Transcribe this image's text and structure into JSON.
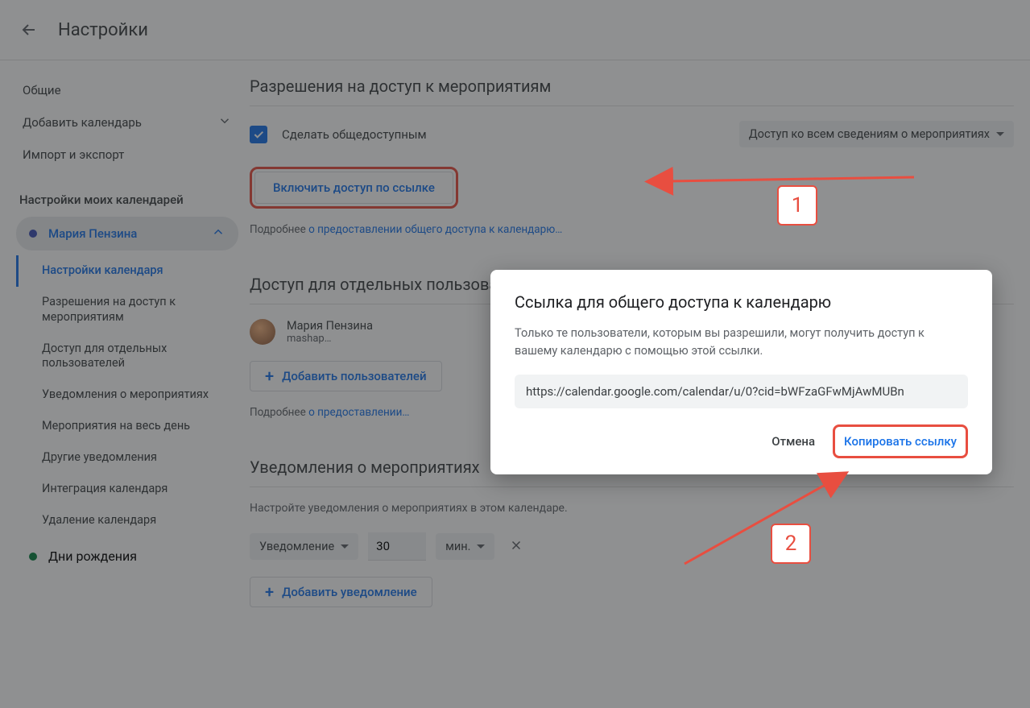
{
  "header": {
    "title": "Настройки"
  },
  "sidebar": {
    "general": "Общие",
    "add_calendar": "Добавить календарь",
    "import_export": "Импорт и экспорт",
    "my_calendars_title": "Настройки моих календарей",
    "calendar_name": "Мария Пензина",
    "subnav": {
      "settings": "Настройки календаря",
      "permissions": "Разрешения на доступ к мероприятиям",
      "access_users": "Доступ для отдельных пользователей",
      "event_notifs": "Уведомления о мероприятиях",
      "all_day": "Мероприятия на весь день",
      "other_notifs": "Другие уведомления",
      "integration": "Интеграция календаря",
      "delete": "Удаление календаря"
    },
    "birthdays": "Дни рождения"
  },
  "sections": {
    "permissions": {
      "title": "Разрешения на доступ к мероприятиям",
      "make_public": "Сделать общедоступным",
      "visibility_option": "Доступ ко всем сведениям о мероприятиях",
      "share_link_btn": "Включить доступ по ссылке",
      "more_prefix": "Подробнее ",
      "more_link": "о предоставлении общего доступа к календарю…"
    },
    "access": {
      "title": "Доступ для отдельных пользователей",
      "user_name": "Мария Пензина",
      "user_email": "mashap…",
      "add_btn": "Добавить пользователей",
      "more_prefix": "Подробнее ",
      "more_link": "о предоставлении…"
    },
    "notifs": {
      "title": "Уведомления о мероприятиях",
      "desc": "Настройте уведомления о мероприятиях в этом календаре.",
      "type": "Уведомление",
      "value": "30",
      "unit": "мин.",
      "add_btn": "Добавить уведомление"
    }
  },
  "dialog": {
    "title": "Ссылка для общего доступа к календарю",
    "desc": "Только те пользователи, которым вы разрешили, могут получить доступ к вашему календарю с помощью этой ссылки.",
    "url": "https://calendar.google.com/calendar/u/0?cid=bWFzaGFwMjAwMUBn",
    "cancel": "Отмена",
    "copy": "Копировать ссылку"
  },
  "annotations": {
    "num1": "1",
    "num2": "2"
  }
}
